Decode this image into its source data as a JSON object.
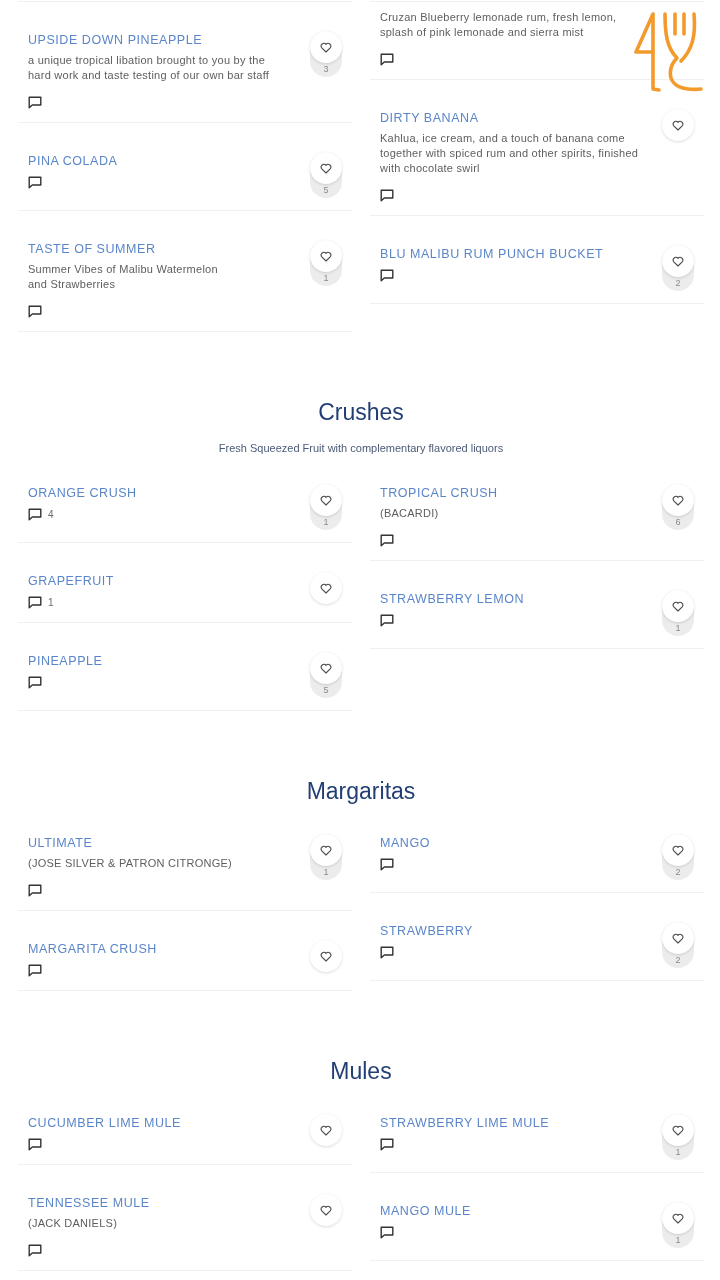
{
  "sections": [
    {
      "columns": [
        [
          {
            "name": "UPSIDE DOWN PINEAPPLE",
            "description": "a unique tropical libation brought to you by the hard work and taste testing of our own bar staff",
            "likes": "3"
          },
          {
            "name": "PINA COLADA",
            "likes": "5"
          },
          {
            "name": "TASTE OF SUMMER",
            "description": "Summer Vibes of Malibu Watermelon\nand Strawberries",
            "likes": "1"
          }
        ],
        [
          {
            "description": "Cruzan Blueberry lemonade rum, fresh lemon, splash of pink lemonade and sierra mist"
          },
          {
            "name": "DIRTY BANANA",
            "description": "Kahlua, ice cream, and a touch of banana come together with spiced rum and other spirits, finished with chocolate swirl"
          },
          {
            "name": "BLU MALIBU RUM PUNCH BUCKET",
            "likes": "2"
          }
        ]
      ]
    },
    {
      "heading": "Crushes",
      "subtitle": "Fresh Squeezed Fruit with complementary flavored liquors",
      "columns": [
        [
          {
            "name": "ORANGE CRUSH",
            "comments": "4",
            "likes": "1"
          },
          {
            "name": "GRAPEFRUIT",
            "comments": "1"
          },
          {
            "name": "PINEAPPLE",
            "likes": "5"
          }
        ],
        [
          {
            "name": "TROPICAL CRUSH",
            "description": "(BACARDI)",
            "likes": "6"
          },
          {
            "name": "STRAWBERRY LEMON",
            "likes": "1"
          }
        ]
      ]
    },
    {
      "heading": "Margaritas",
      "columns": [
        [
          {
            "name": "ULTIMATE",
            "description": "(JOSE SILVER & PATRON CITRONGE)",
            "likes": "1"
          },
          {
            "name": "MARGARITA CRUSH"
          }
        ],
        [
          {
            "name": "MANGO",
            "likes": "2"
          },
          {
            "name": "STRAWBERRY",
            "likes": "2"
          }
        ]
      ]
    },
    {
      "heading": "Mules",
      "columns": [
        [
          {
            "name": "CUCUMBER LIME MULE"
          },
          {
            "name": "TENNESSEE MULE",
            "description": "(JACK DANIELS)"
          }
        ],
        [
          {
            "name": "STRAWBERRY LIME MULE",
            "likes": "1"
          },
          {
            "name": "MANGO MULE",
            "likes": "1"
          }
        ]
      ]
    }
  ]
}
